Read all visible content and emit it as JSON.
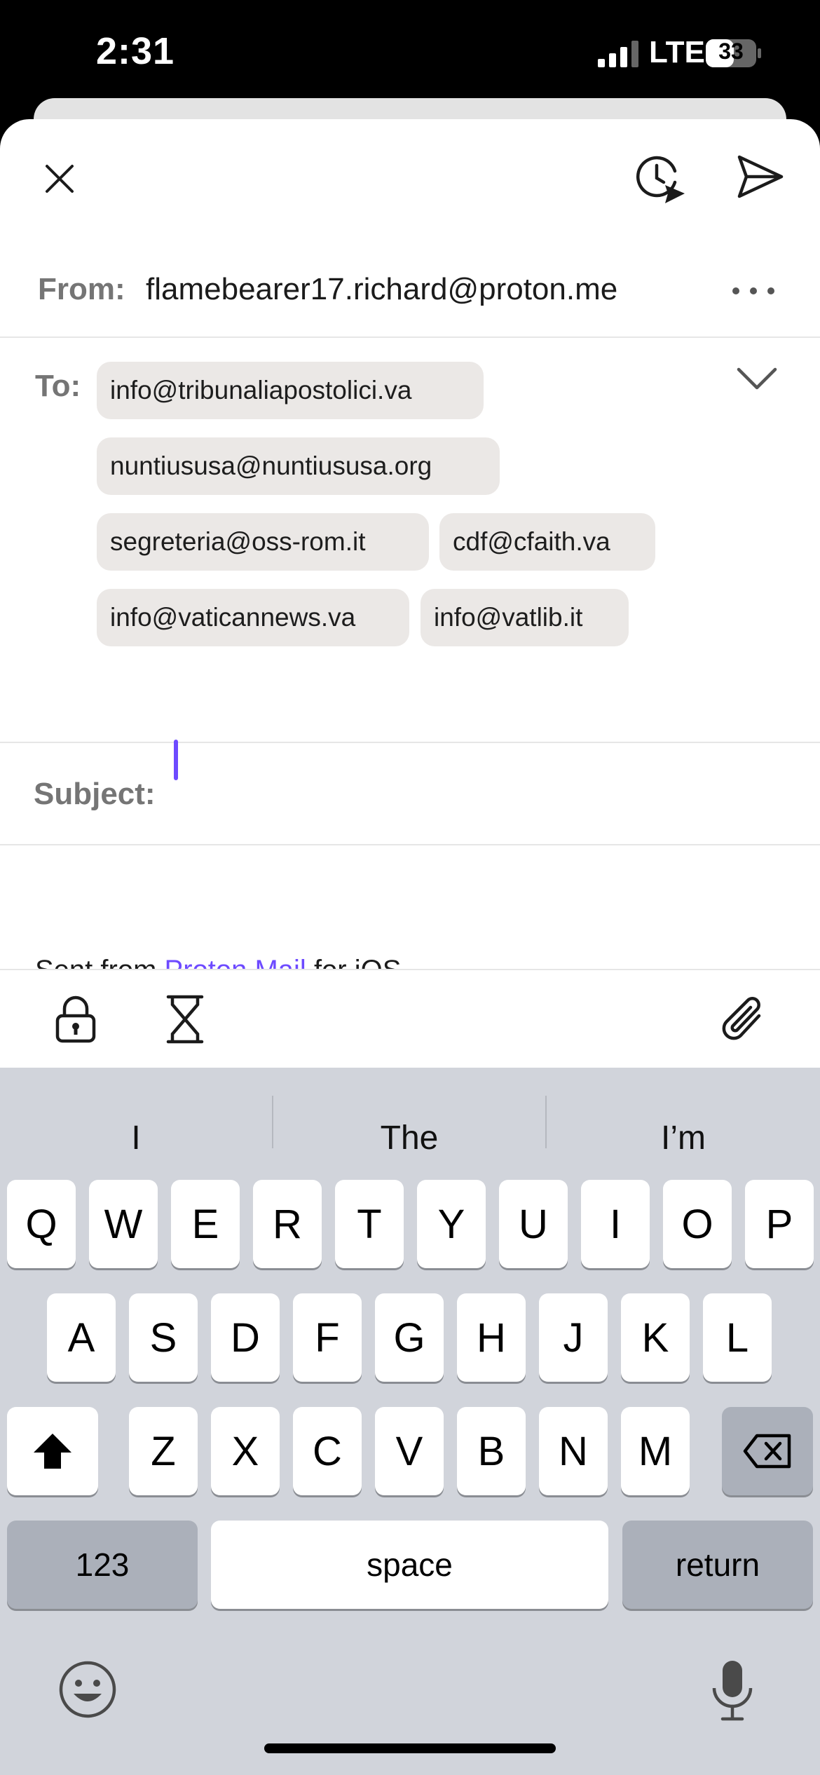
{
  "status_bar": {
    "time": "2:31",
    "network": "LTE",
    "battery": "33"
  },
  "compose": {
    "from_label": "From:",
    "from_value": "flamebearer17.richard@proton.me",
    "to_label": "To:",
    "recipients": [
      "info@tribunaliapostolici.va",
      "nuntiususa@nuntiususa.org",
      "segreteria@oss-rom.it",
      "cdf@cfaith.va",
      "info@vaticannews.va",
      "info@vatlib.it"
    ],
    "subject_label": "Subject:",
    "subject_value": "",
    "signature_prefix": "Sent from ",
    "signature_link": "Proton Mail",
    "signature_suffix": " for iOS"
  },
  "icons": {
    "close": "close-icon",
    "schedule": "schedule-send-icon",
    "send": "send-icon",
    "more": "more-icon",
    "expand": "chevron-down-icon",
    "encrypt": "lock-icon",
    "expiration": "hourglass-icon",
    "attach": "paperclip-icon"
  },
  "keyboard": {
    "suggestions": [
      "I",
      "The",
      "I’m"
    ],
    "row1": [
      "Q",
      "W",
      "E",
      "R",
      "T",
      "Y",
      "U",
      "I",
      "O",
      "P"
    ],
    "row2": [
      "A",
      "S",
      "D",
      "F",
      "G",
      "H",
      "J",
      "K",
      "L"
    ],
    "row3": [
      "Z",
      "X",
      "C",
      "V",
      "B",
      "N",
      "M"
    ],
    "numbers_label": "123",
    "space_label": "space",
    "return_label": "return"
  },
  "colors": {
    "accent": "#6d4aff",
    "chip_bg": "#ebe8e6",
    "keyboard_bg": "#d1d4db"
  }
}
